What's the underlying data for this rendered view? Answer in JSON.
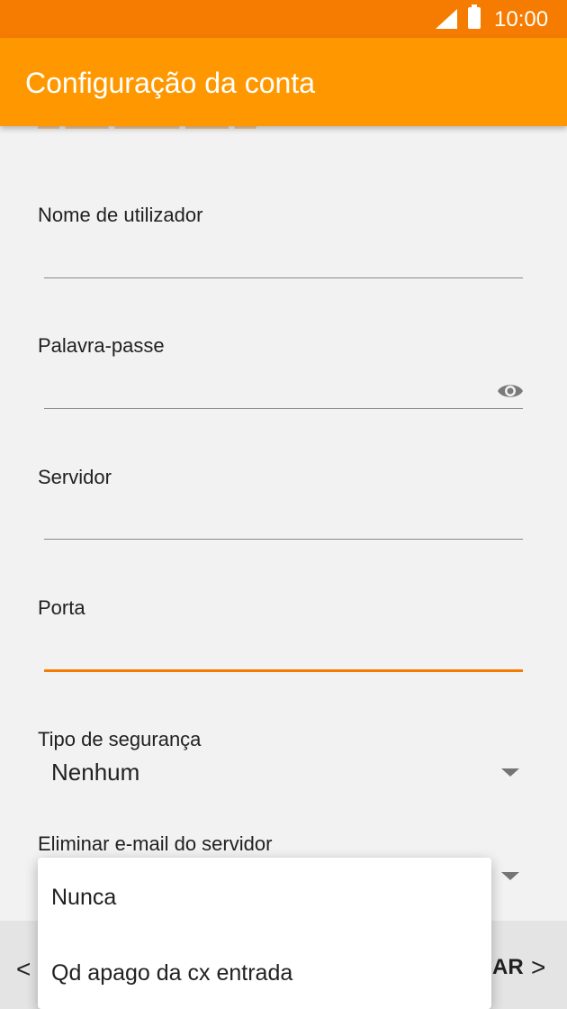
{
  "status_bar": {
    "time": "10:00",
    "signal_icon": "signal-icon",
    "battery_icon": "battery-icon"
  },
  "app_bar": {
    "title": "Configuração da conta"
  },
  "form": {
    "username": {
      "label": "Nome de utilizador",
      "value": ""
    },
    "password": {
      "label": "Palavra-passe",
      "value": "",
      "toggle_icon": "eye-icon"
    },
    "server": {
      "label": "Servidor",
      "value": ""
    },
    "port": {
      "label": "Porta",
      "value": ""
    },
    "security_type": {
      "label": "Tipo de segurança",
      "value": "Nenhum"
    },
    "delete_email": {
      "label": "Eliminar e-mail do servidor"
    }
  },
  "popup_menu": {
    "options": [
      "Nunca",
      "Qd apago da cx entrada"
    ]
  },
  "bottom_nav": {
    "prev_icon": "chevron-left-icon",
    "next_label": "AR",
    "next_icon": "chevron-right-icon"
  },
  "colors": {
    "status_bar": "#f57c00",
    "app_bar": "#ff9800",
    "accent": "#f57c00"
  }
}
